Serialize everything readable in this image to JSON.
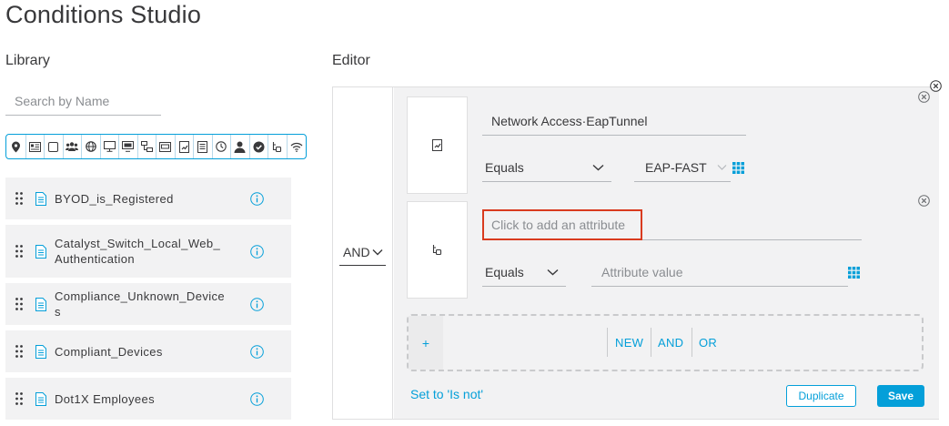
{
  "page_title": "Conditions Studio",
  "library": {
    "label": "Library",
    "search_placeholder": "Search by Name",
    "filter_icons": [
      "location-pin-icon",
      "id-card-icon",
      "square-icon",
      "users-group-icon",
      "globe-icon",
      "monitor-icon",
      "desktop-icon",
      "network-icon",
      "card-icon",
      "certificate-icon",
      "list-document-icon",
      "clock-icon",
      "user-icon",
      "shield-check-icon",
      "eap-tunnel-icon",
      "wifi-icon"
    ],
    "items": [
      {
        "name": "BYOD_is_Registered"
      },
      {
        "name": "Catalyst_Switch_Local_Web_Authentication"
      },
      {
        "name": "Compliance_Unknown_Devices"
      },
      {
        "name": "Compliant_Devices"
      },
      {
        "name": "Dot1X Employees"
      }
    ]
  },
  "editor": {
    "label": "Editor",
    "operator": "AND",
    "conditions": [
      {
        "dictionary_icon": "certificate-icon",
        "attribute": "Network Access·EapTunnel",
        "operator": "Equals",
        "value": "EAP-FAST"
      },
      {
        "dictionary_icon": "eap-tunnel-icon",
        "attribute_placeholder": "Click to add an attribute",
        "operator": "Equals",
        "value_placeholder": "Attribute value"
      }
    ],
    "add_plus": "+",
    "new_label": "NEW",
    "and_label": "AND",
    "or_label": "OR",
    "is_not_link": "Set to 'Is not'",
    "duplicate_label": "Duplicate",
    "save_label": "Save"
  },
  "colors": {
    "accent": "#049fd9",
    "highlight_border": "#d93b1f",
    "panel_bg": "#f2f2f3"
  }
}
